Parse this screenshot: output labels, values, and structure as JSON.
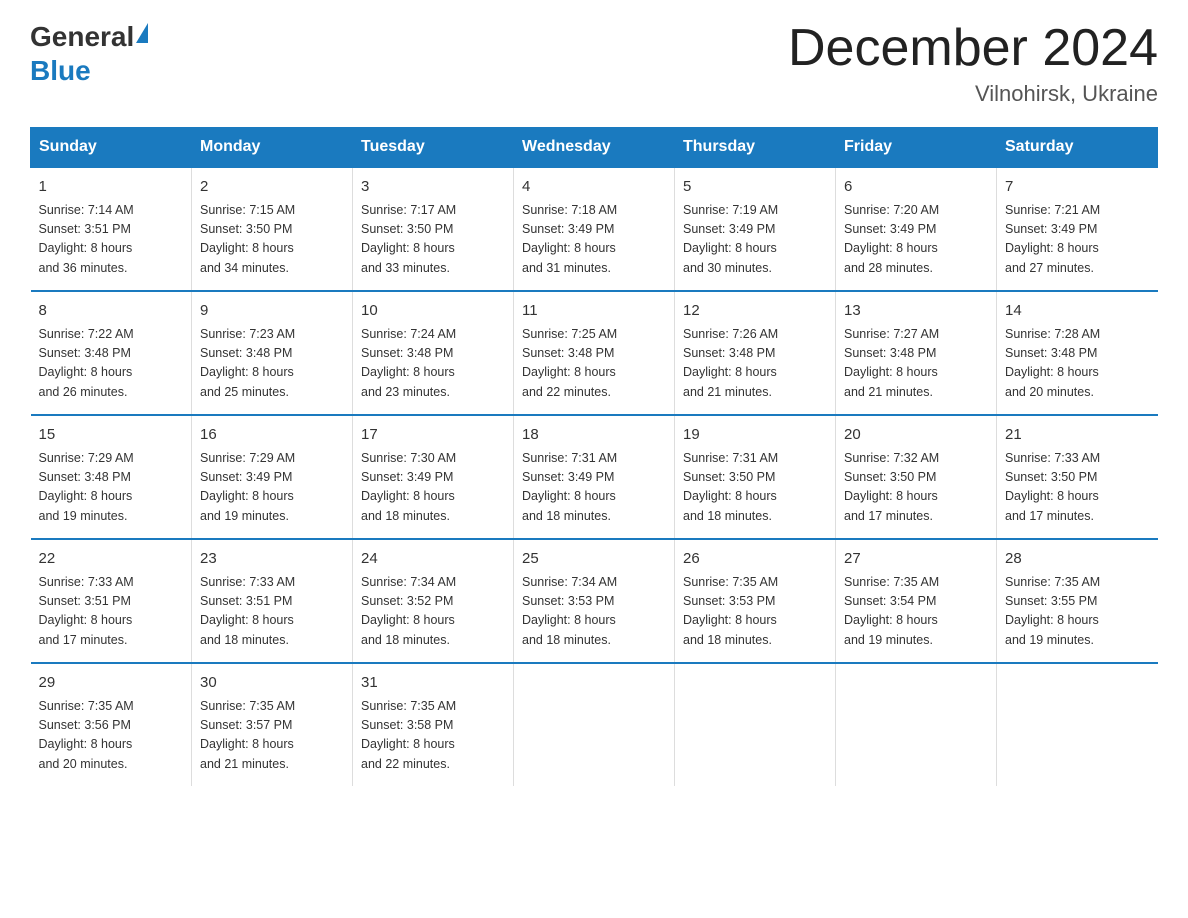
{
  "header": {
    "logo_general": "General",
    "logo_blue": "Blue",
    "month_title": "December 2024",
    "location": "Vilnohirsk, Ukraine"
  },
  "days_of_week": [
    "Sunday",
    "Monday",
    "Tuesday",
    "Wednesday",
    "Thursday",
    "Friday",
    "Saturday"
  ],
  "weeks": [
    [
      {
        "day": "1",
        "sunrise": "7:14 AM",
        "sunset": "3:51 PM",
        "daylight": "8 hours and 36 minutes."
      },
      {
        "day": "2",
        "sunrise": "7:15 AM",
        "sunset": "3:50 PM",
        "daylight": "8 hours and 34 minutes."
      },
      {
        "day": "3",
        "sunrise": "7:17 AM",
        "sunset": "3:50 PM",
        "daylight": "8 hours and 33 minutes."
      },
      {
        "day": "4",
        "sunrise": "7:18 AM",
        "sunset": "3:49 PM",
        "daylight": "8 hours and 31 minutes."
      },
      {
        "day": "5",
        "sunrise": "7:19 AM",
        "sunset": "3:49 PM",
        "daylight": "8 hours and 30 minutes."
      },
      {
        "day": "6",
        "sunrise": "7:20 AM",
        "sunset": "3:49 PM",
        "daylight": "8 hours and 28 minutes."
      },
      {
        "day": "7",
        "sunrise": "7:21 AM",
        "sunset": "3:49 PM",
        "daylight": "8 hours and 27 minutes."
      }
    ],
    [
      {
        "day": "8",
        "sunrise": "7:22 AM",
        "sunset": "3:48 PM",
        "daylight": "8 hours and 26 minutes."
      },
      {
        "day": "9",
        "sunrise": "7:23 AM",
        "sunset": "3:48 PM",
        "daylight": "8 hours and 25 minutes."
      },
      {
        "day": "10",
        "sunrise": "7:24 AM",
        "sunset": "3:48 PM",
        "daylight": "8 hours and 23 minutes."
      },
      {
        "day": "11",
        "sunrise": "7:25 AM",
        "sunset": "3:48 PM",
        "daylight": "8 hours and 22 minutes."
      },
      {
        "day": "12",
        "sunrise": "7:26 AM",
        "sunset": "3:48 PM",
        "daylight": "8 hours and 21 minutes."
      },
      {
        "day": "13",
        "sunrise": "7:27 AM",
        "sunset": "3:48 PM",
        "daylight": "8 hours and 21 minutes."
      },
      {
        "day": "14",
        "sunrise": "7:28 AM",
        "sunset": "3:48 PM",
        "daylight": "8 hours and 20 minutes."
      }
    ],
    [
      {
        "day": "15",
        "sunrise": "7:29 AM",
        "sunset": "3:48 PM",
        "daylight": "8 hours and 19 minutes."
      },
      {
        "day": "16",
        "sunrise": "7:29 AM",
        "sunset": "3:49 PM",
        "daylight": "8 hours and 19 minutes."
      },
      {
        "day": "17",
        "sunrise": "7:30 AM",
        "sunset": "3:49 PM",
        "daylight": "8 hours and 18 minutes."
      },
      {
        "day": "18",
        "sunrise": "7:31 AM",
        "sunset": "3:49 PM",
        "daylight": "8 hours and 18 minutes."
      },
      {
        "day": "19",
        "sunrise": "7:31 AM",
        "sunset": "3:50 PM",
        "daylight": "8 hours and 18 minutes."
      },
      {
        "day": "20",
        "sunrise": "7:32 AM",
        "sunset": "3:50 PM",
        "daylight": "8 hours and 17 minutes."
      },
      {
        "day": "21",
        "sunrise": "7:33 AM",
        "sunset": "3:50 PM",
        "daylight": "8 hours and 17 minutes."
      }
    ],
    [
      {
        "day": "22",
        "sunrise": "7:33 AM",
        "sunset": "3:51 PM",
        "daylight": "8 hours and 17 minutes."
      },
      {
        "day": "23",
        "sunrise": "7:33 AM",
        "sunset": "3:51 PM",
        "daylight": "8 hours and 18 minutes."
      },
      {
        "day": "24",
        "sunrise": "7:34 AM",
        "sunset": "3:52 PM",
        "daylight": "8 hours and 18 minutes."
      },
      {
        "day": "25",
        "sunrise": "7:34 AM",
        "sunset": "3:53 PM",
        "daylight": "8 hours and 18 minutes."
      },
      {
        "day": "26",
        "sunrise": "7:35 AM",
        "sunset": "3:53 PM",
        "daylight": "8 hours and 18 minutes."
      },
      {
        "day": "27",
        "sunrise": "7:35 AM",
        "sunset": "3:54 PM",
        "daylight": "8 hours and 19 minutes."
      },
      {
        "day": "28",
        "sunrise": "7:35 AM",
        "sunset": "3:55 PM",
        "daylight": "8 hours and 19 minutes."
      }
    ],
    [
      {
        "day": "29",
        "sunrise": "7:35 AM",
        "sunset": "3:56 PM",
        "daylight": "8 hours and 20 minutes."
      },
      {
        "day": "30",
        "sunrise": "7:35 AM",
        "sunset": "3:57 PM",
        "daylight": "8 hours and 21 minutes."
      },
      {
        "day": "31",
        "sunrise": "7:35 AM",
        "sunset": "3:58 PM",
        "daylight": "8 hours and 22 minutes."
      },
      null,
      null,
      null,
      null
    ]
  ],
  "labels": {
    "sunrise": "Sunrise:",
    "sunset": "Sunset:",
    "daylight": "Daylight:"
  }
}
